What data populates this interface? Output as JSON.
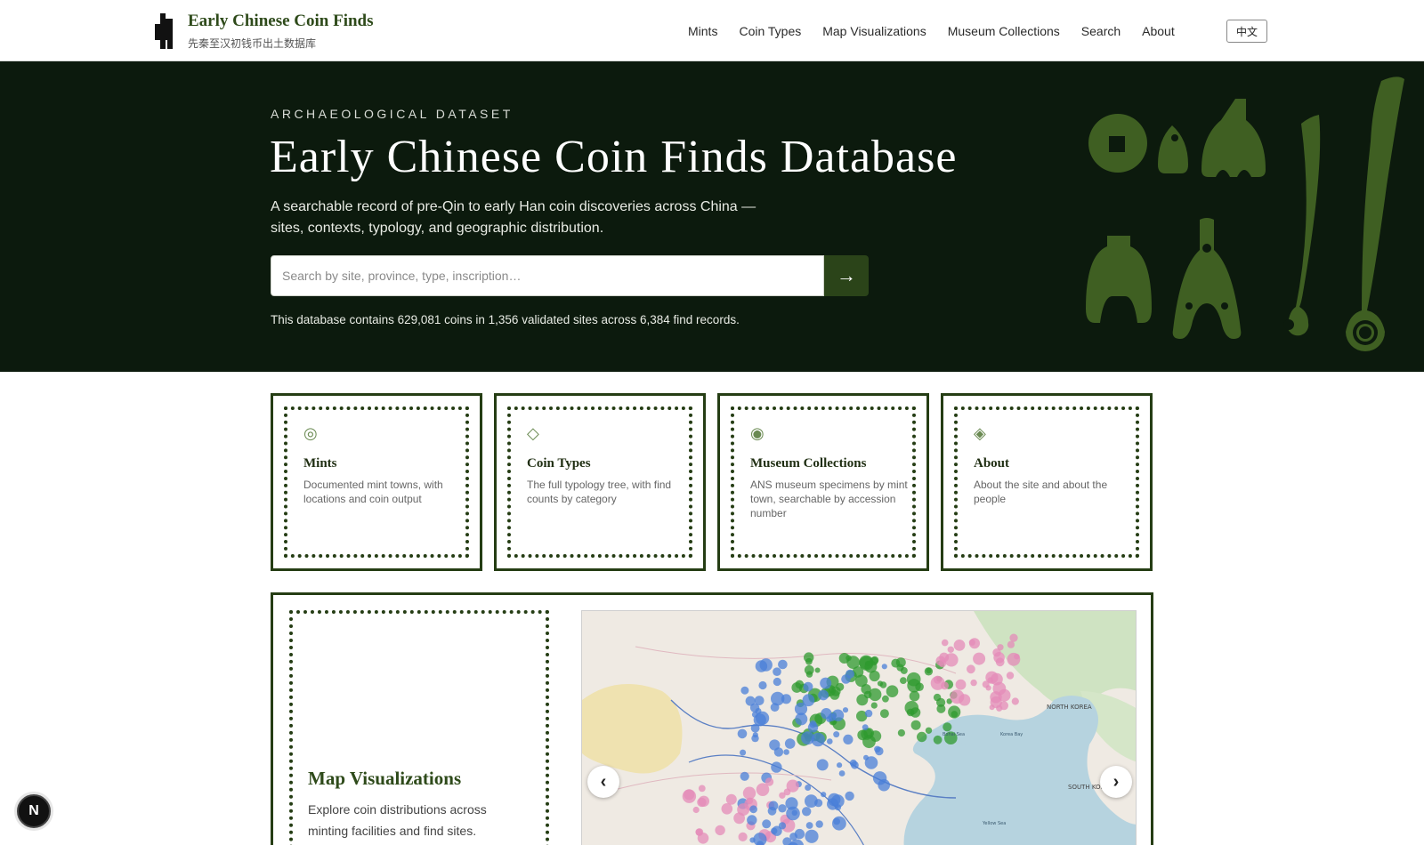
{
  "header": {
    "title": "Early Chinese Coin Finds",
    "subtitle": "先秦至汉初钱币出土数据库",
    "nav": [
      "Mints",
      "Coin Types",
      "Map Visualizations",
      "Museum Collections",
      "Search",
      "About"
    ],
    "lang_button": "中文"
  },
  "hero": {
    "eyebrow": "ARCHAEOLOGICAL DATASET",
    "title": "Early Chinese Coin Finds Database",
    "description": "A searchable record of pre-Qin to early Han coin discoveries across China — sites, contexts, typology, and geographic distribution.",
    "search_placeholder": "Search by site, province, type, inscription…",
    "search_button": "→",
    "stats": "This database contains 629,081 coins in 1,356 validated sites across 6,384 find records."
  },
  "cards": [
    {
      "icon": "◎",
      "icon_name": "target-icon",
      "title": "Mints",
      "desc": "Documented mint towns, with locations and coin output"
    },
    {
      "icon": "◇",
      "icon_name": "diamond-icon",
      "title": "Coin Types",
      "desc": "The full typology tree, with find counts by category"
    },
    {
      "icon": "◉",
      "icon_name": "disc-icon",
      "title": "Museum Collections",
      "desc": "ANS museum specimens by mint town, searchable by accession number"
    },
    {
      "icon": "◈",
      "icon_name": "diamond-dot-icon",
      "title": "About",
      "desc": "About the site and about the people"
    }
  ],
  "map_section": {
    "title": "Map Visualizations",
    "desc": "Explore coin distributions across minting facilities and find sites.",
    "prev": "‹",
    "next": "›",
    "map_labels": [
      "NORTH KOREA",
      "SOUTH KOREA",
      "Bohai Sea",
      "Yellow Sea",
      "Korea Bay"
    ]
  },
  "floating_badge": "N",
  "colors": {
    "brand_dark": "#2b4419",
    "hero_bg": "#0c1a0d",
    "coin_silhouette": "#3f5f22",
    "dot_green": "#2f9a2f",
    "dot_blue": "#4a7fd8",
    "dot_pink": "#e48bb8"
  }
}
